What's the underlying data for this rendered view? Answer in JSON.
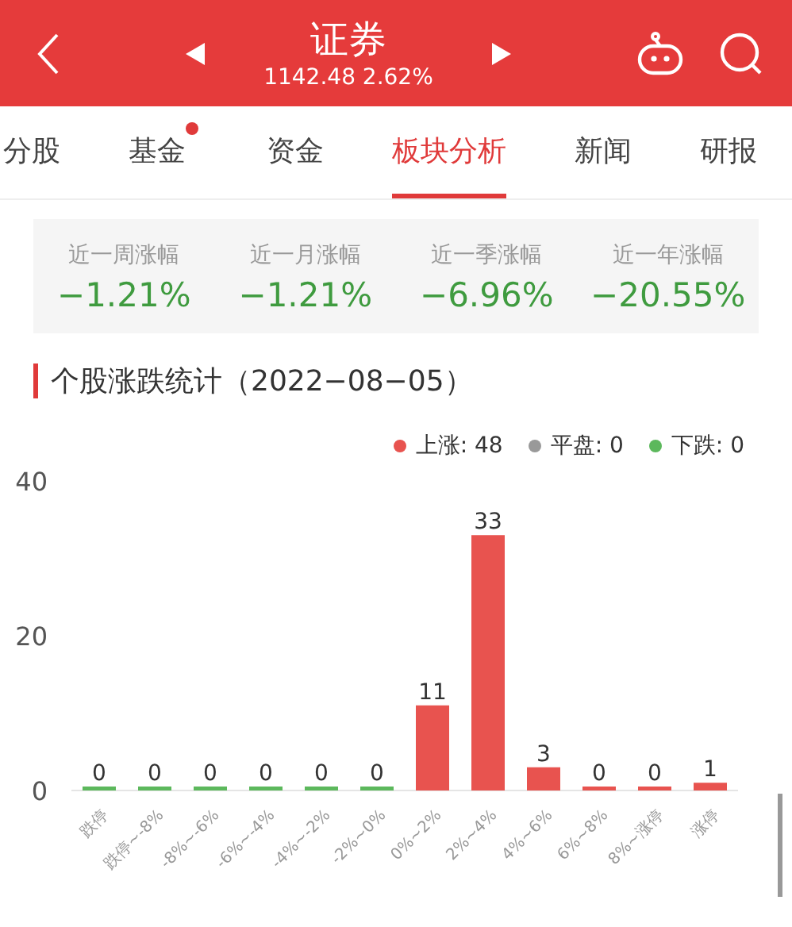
{
  "header": {
    "title": "证券",
    "quote": "1142.48 2.62%"
  },
  "tabs": [
    {
      "label": "分股",
      "selected": false,
      "dot": false
    },
    {
      "label": "基金",
      "selected": false,
      "dot": true
    },
    {
      "label": "资金",
      "selected": false,
      "dot": false
    },
    {
      "label": "板块分析",
      "selected": true,
      "dot": false
    },
    {
      "label": "新闻",
      "selected": false,
      "dot": false
    },
    {
      "label": "研报",
      "selected": false,
      "dot": false
    }
  ],
  "stats": [
    {
      "label": "近一周涨幅",
      "value": "−1.21%"
    },
    {
      "label": "近一月涨幅",
      "value": "−1.21%"
    },
    {
      "label": "近一季涨幅",
      "value": "−6.96%"
    },
    {
      "label": "近一年涨幅",
      "value": "−20.55%"
    }
  ],
  "section_title": "个股涨跌统计（2022−08−05）",
  "legend": [
    {
      "label": "上涨: 48",
      "color": "#e8534f"
    },
    {
      "label": "平盘: 0",
      "color": "#999999"
    },
    {
      "label": "下跌: 0",
      "color": "#5cb85c"
    }
  ],
  "chart_data": {
    "type": "bar",
    "categories": [
      "跌停",
      "跌停~-8%",
      "-8%~-6%",
      "-6%~-4%",
      "-4%~-2%",
      "-2%~0%",
      "0%~2%",
      "2%~4%",
      "4%~6%",
      "6%~8%",
      "8%~涨停",
      "涨停"
    ],
    "series": [
      {
        "color": "#5cb85c",
        "values": [
          0,
          0,
          0,
          0,
          0,
          0,
          null,
          null,
          null,
          null,
          null,
          null
        ]
      },
      {
        "color": "#e8534f",
        "values": [
          null,
          null,
          null,
          null,
          null,
          null,
          11,
          33,
          3,
          0,
          0,
          1
        ]
      }
    ],
    "ylim": [
      0,
      40
    ],
    "yticks": [
      0,
      20,
      40
    ],
    "data_labels": true
  }
}
